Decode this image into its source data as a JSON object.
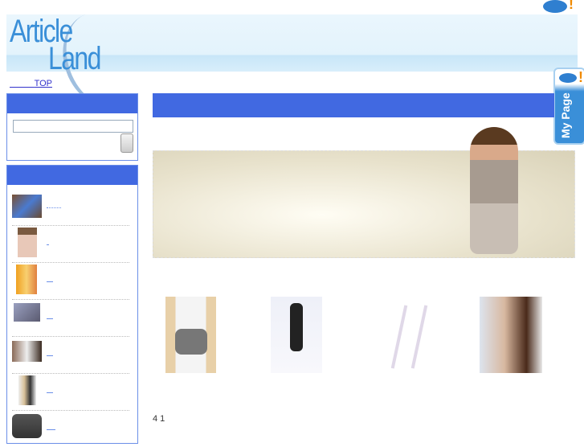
{
  "header": {
    "logo_line1": "Article",
    "logo_line2": "Land",
    "mypage_label": "My Page"
  },
  "breadcrumb": {
    "top_link": "TOP"
  },
  "footer": {
    "count_text": "4 1"
  }
}
